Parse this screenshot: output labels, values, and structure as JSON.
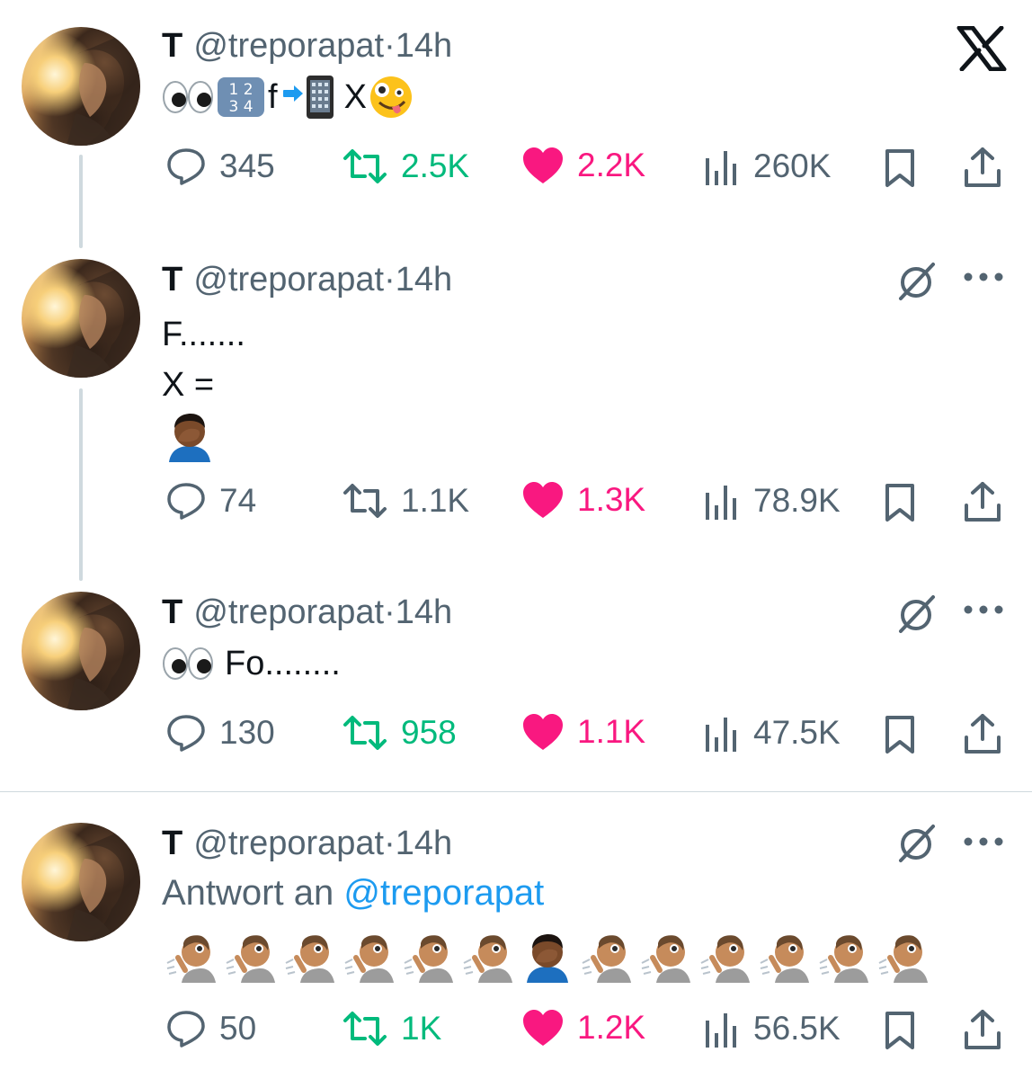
{
  "app": {
    "logo_icon": "x-logo-icon"
  },
  "colors": {
    "retweet_active": "#00ba7c",
    "like_active": "#f91880",
    "muted": "#536471",
    "mention": "#1d9bf0"
  },
  "tweets": [
    {
      "name": "T",
      "handle": "@treporapat",
      "sep": "·",
      "time": "14h",
      "text_parts": [
        "f",
        "X"
      ],
      "counts": {
        "replies": "345",
        "retweets": "2.5K",
        "likes": "2.2K",
        "views": "260K"
      },
      "retweeted": true,
      "liked": true
    },
    {
      "name": "T",
      "handle": "@treporapat",
      "sep": "·",
      "time": "14h",
      "text": "F.......\nX =",
      "counts": {
        "replies": "74",
        "retweets": "1.1K",
        "likes": "1.3K",
        "views": "78.9K"
      },
      "retweeted": false,
      "liked": true
    },
    {
      "name": "T",
      "handle": "@treporapat",
      "sep": "·",
      "time": "14h",
      "text": "Fo........",
      "counts": {
        "replies": "130",
        "retweets": "958",
        "likes": "1.1K",
        "views": "47.5K"
      },
      "retweeted": true,
      "liked": true
    },
    {
      "name": "T",
      "handle": "@treporapat",
      "sep": "·",
      "time": "14h",
      "reply_prefix": "Antwort an",
      "reply_mention": "@treporapat",
      "counts": {
        "replies": "50",
        "retweets": "1K",
        "likes": "1.2K",
        "views": "56.5K"
      },
      "retweeted": true,
      "liked": true
    }
  ]
}
